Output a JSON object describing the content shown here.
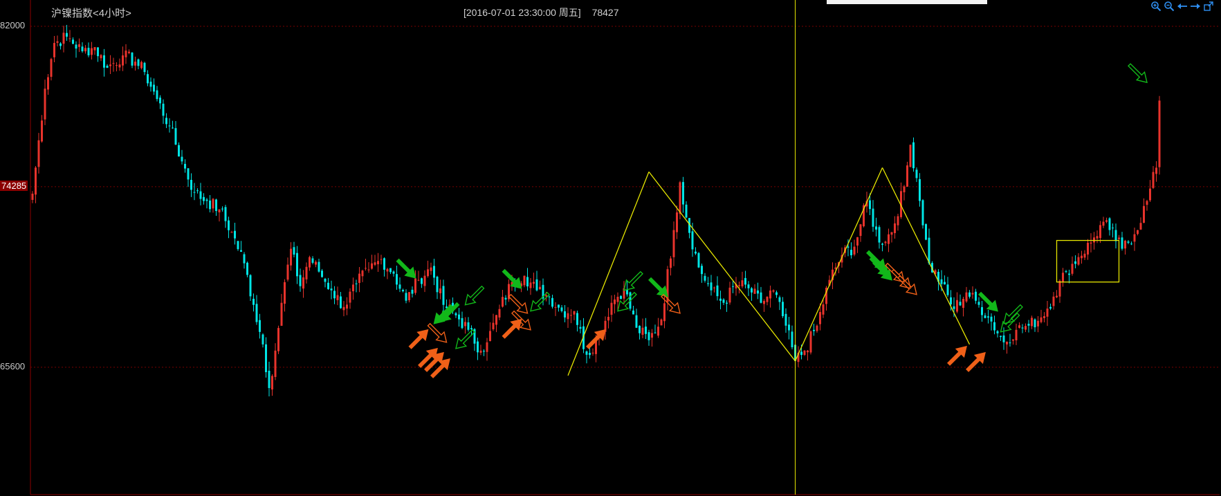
{
  "header": {
    "title": "沪镍指数<4小时>",
    "datetime": "[2016-07-01  23:30:00 周五]",
    "value": "78427"
  },
  "toolbar": {
    "icons": [
      "zoom-in-icon",
      "zoom-out-icon",
      "arrow-left-icon",
      "arrow-right-icon",
      "detach-icon"
    ]
  },
  "colors": {
    "up": "#e8332c",
    "down": "#00e5e5",
    "trend": "#e6e600",
    "grid": "#7a0000",
    "axis": "#8b0000",
    "arrow_green": "#12b81a",
    "arrow_orange": "#f06018"
  },
  "chart_data": {
    "type": "candlestick",
    "title": "沪镍指数<4小时>",
    "y_tick_labels": [
      {
        "value": 82000,
        "label": "82000"
      },
      {
        "value": 74285,
        "label": "74285"
      },
      {
        "value": 65600,
        "label": "65600"
      }
    ],
    "ylim": [
      63400,
      82600
    ],
    "grid": "horizontal dashed lines at labeled ticks",
    "crosshair_index": 245,
    "anchors": [
      [
        0,
        73950
      ],
      [
        4,
        79000
      ],
      [
        7,
        81200
      ],
      [
        11,
        81500
      ],
      [
        16,
        80800
      ],
      [
        20,
        81000
      ],
      [
        24,
        80000
      ],
      [
        29,
        80600
      ],
      [
        33,
        80300
      ],
      [
        36,
        79800
      ],
      [
        40,
        78500
      ],
      [
        44,
        77200
      ],
      [
        48,
        75500
      ],
      [
        52,
        74000
      ],
      [
        56,
        73600
      ],
      [
        60,
        73200
      ],
      [
        64,
        72100
      ],
      [
        68,
        70600
      ],
      [
        71,
        68600
      ],
      [
        74,
        66700
      ],
      [
        76,
        64600
      ],
      [
        78,
        66400
      ],
      [
        80,
        68700
      ],
      [
        83,
        71300
      ],
      [
        86,
        69500
      ],
      [
        89,
        70900
      ],
      [
        92,
        70200
      ],
      [
        96,
        69300
      ],
      [
        100,
        68500
      ],
      [
        104,
        69600
      ],
      [
        108,
        70300
      ],
      [
        112,
        70800
      ],
      [
        116,
        70100
      ],
      [
        120,
        68800
      ],
      [
        124,
        69800
      ],
      [
        128,
        70400
      ],
      [
        132,
        68600
      ],
      [
        136,
        68100
      ],
      [
        140,
        67400
      ],
      [
        144,
        66400
      ],
      [
        146,
        66800
      ],
      [
        150,
        68400
      ],
      [
        154,
        69700
      ],
      [
        158,
        70000
      ],
      [
        162,
        69300
      ],
      [
        166,
        69000
      ],
      [
        170,
        68300
      ],
      [
        174,
        68300
      ],
      [
        178,
        66200
      ],
      [
        182,
        67100
      ],
      [
        186,
        68700
      ],
      [
        190,
        69400
      ],
      [
        194,
        67500
      ],
      [
        198,
        66900
      ],
      [
        202,
        67900
      ],
      [
        206,
        72200
      ],
      [
        208,
        74500
      ],
      [
        210,
        72800
      ],
      [
        214,
        70400
      ],
      [
        218,
        69300
      ],
      [
        222,
        68700
      ],
      [
        226,
        69600
      ],
      [
        230,
        69400
      ],
      [
        234,
        68700
      ],
      [
        238,
        69300
      ],
      [
        242,
        67600
      ],
      [
        245,
        65900
      ],
      [
        248,
        66400
      ],
      [
        252,
        67600
      ],
      [
        256,
        69800
      ],
      [
        260,
        71000
      ],
      [
        264,
        71400
      ],
      [
        268,
        73600
      ],
      [
        272,
        71600
      ],
      [
        276,
        72100
      ],
      [
        280,
        74300
      ],
      [
        282,
        76300
      ],
      [
        284,
        74700
      ],
      [
        288,
        70600
      ],
      [
        292,
        69600
      ],
      [
        296,
        68400
      ],
      [
        300,
        69200
      ],
      [
        304,
        68600
      ],
      [
        308,
        67800
      ],
      [
        312,
        66800
      ],
      [
        316,
        67400
      ],
      [
        320,
        67600
      ],
      [
        324,
        68000
      ],
      [
        328,
        69000
      ],
      [
        332,
        70200
      ],
      [
        336,
        70900
      ],
      [
        340,
        71600
      ],
      [
        344,
        72600
      ],
      [
        346,
        72200
      ],
      [
        350,
        71300
      ],
      [
        354,
        72000
      ],
      [
        358,
        73600
      ],
      [
        361,
        75200
      ],
      [
        362,
        78427
      ]
    ],
    "trend_lines": [
      [
        [
          172,
          65200
        ],
        [
          198,
          75000
        ]
      ],
      [
        [
          198,
          75000
        ],
        [
          245,
          65900
        ]
      ],
      [
        [
          245,
          65900
        ],
        [
          273,
          75200
        ]
      ],
      [
        [
          273,
          75200
        ],
        [
          301,
          66700
        ]
      ]
    ],
    "rectangle": {
      "x": [
        329,
        349
      ],
      "y": [
        69700,
        71700
      ]
    },
    "markers": [
      {
        "idx": 123,
        "val": 69900,
        "color": "green",
        "dir": "dr",
        "filled": true
      },
      {
        "idx": 131,
        "val": 67800,
        "color": "green",
        "dir": "dl",
        "filled": true
      },
      {
        "idx": 129,
        "val": 67700,
        "color": "green",
        "dir": "dl",
        "filled": true
      },
      {
        "idx": 139,
        "val": 68600,
        "color": "green",
        "dir": "dl",
        "filled": false
      },
      {
        "idx": 136,
        "val": 66500,
        "color": "green",
        "dir": "dl",
        "filled": false
      },
      {
        "idx": 127,
        "val": 67400,
        "color": "orange",
        "dir": "ur",
        "filled": true
      },
      {
        "idx": 130,
        "val": 66500,
        "color": "orange",
        "dir": "ur",
        "filled": true
      },
      {
        "idx": 132,
        "val": 66300,
        "color": "orange",
        "dir": "ur",
        "filled": true
      },
      {
        "idx": 134,
        "val": 66000,
        "color": "orange",
        "dir": "ur",
        "filled": true
      },
      {
        "idx": 133,
        "val": 66800,
        "color": "orange",
        "dir": "dr",
        "filled": false
      },
      {
        "idx": 157,
        "val": 69400,
        "color": "green",
        "dir": "dr",
        "filled": true
      },
      {
        "idx": 160,
        "val": 68300,
        "color": "green",
        "dir": "dl",
        "filled": false
      },
      {
        "idx": 157,
        "val": 67900,
        "color": "orange",
        "dir": "ur",
        "filled": true
      },
      {
        "idx": 159,
        "val": 68200,
        "color": "orange",
        "dir": "dr",
        "filled": false
      },
      {
        "idx": 160,
        "val": 67400,
        "color": "orange",
        "dir": "dr",
        "filled": false
      },
      {
        "idx": 184,
        "val": 67400,
        "color": "orange",
        "dir": "ur",
        "filled": true
      },
      {
        "idx": 188,
        "val": 68300,
        "color": "green",
        "dir": "dl",
        "filled": false
      },
      {
        "idx": 190,
        "val": 69300,
        "color": "green",
        "dir": "dl",
        "filled": false
      },
      {
        "idx": 204,
        "val": 69000,
        "color": "green",
        "dir": "dr",
        "filled": true
      },
      {
        "idx": 208,
        "val": 68200,
        "color": "orange",
        "dir": "dr",
        "filled": false
      },
      {
        "idx": 274,
        "val": 70300,
        "color": "green",
        "dir": "dr",
        "filled": true
      },
      {
        "idx": 275,
        "val": 70000,
        "color": "green",
        "dir": "dr",
        "filled": true
      },
      {
        "idx": 276,
        "val": 69800,
        "color": "green",
        "dir": "dr",
        "filled": true
      },
      {
        "idx": 280,
        "val": 69700,
        "color": "orange",
        "dir": "dr",
        "filled": false
      },
      {
        "idx": 282,
        "val": 69400,
        "color": "orange",
        "dir": "dr",
        "filled": false
      },
      {
        "idx": 284,
        "val": 69100,
        "color": "orange",
        "dir": "dr",
        "filled": false
      },
      {
        "idx": 300,
        "val": 66600,
        "color": "orange",
        "dir": "ur",
        "filled": true
      },
      {
        "idx": 306,
        "val": 66300,
        "color": "orange",
        "dir": "ur",
        "filled": true
      },
      {
        "idx": 310,
        "val": 68300,
        "color": "green",
        "dir": "dr",
        "filled": true
      },
      {
        "idx": 311,
        "val": 67300,
        "color": "green",
        "dir": "dl",
        "filled": false
      },
      {
        "idx": 312,
        "val": 67700,
        "color": "green",
        "dir": "dl",
        "filled": false
      },
      {
        "idx": 358,
        "val": 79300,
        "color": "green",
        "dir": "dr",
        "filled": false
      }
    ]
  }
}
